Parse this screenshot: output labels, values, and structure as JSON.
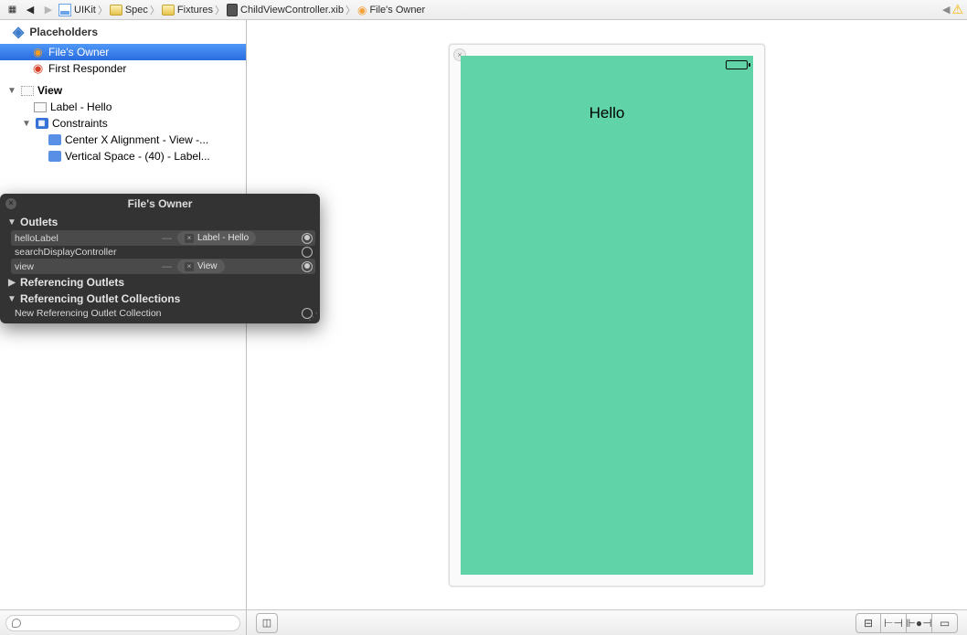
{
  "breadcrumb": {
    "items": [
      "UIKit",
      "Spec",
      "Fixtures",
      "ChildViewController.xib",
      "File's Owner"
    ]
  },
  "outline": {
    "placeholders_title": "Placeholders",
    "files_owner": "File's Owner",
    "first_responder": "First Responder",
    "view": "View",
    "label_item": "Label - Hello",
    "constraints": "Constraints",
    "constraint_centerx": "Center X Alignment - View -...",
    "constraint_vspace": "Vertical Space - (40) - Label..."
  },
  "popover": {
    "title": "File's Owner",
    "sections": {
      "outlets": "Outlets",
      "ref_outlets": "Referencing Outlets",
      "ref_collections": "Referencing Outlet Collections"
    },
    "rows": {
      "helloLabel": {
        "name": "helloLabel",
        "target": "Label - Hello"
      },
      "searchDisplayController": {
        "name": "searchDisplayController"
      },
      "view": {
        "name": "view",
        "target": "View"
      },
      "newRefCollection": {
        "name": "New Referencing Outlet Collection"
      }
    }
  },
  "canvas": {
    "label_text": "Hello"
  }
}
